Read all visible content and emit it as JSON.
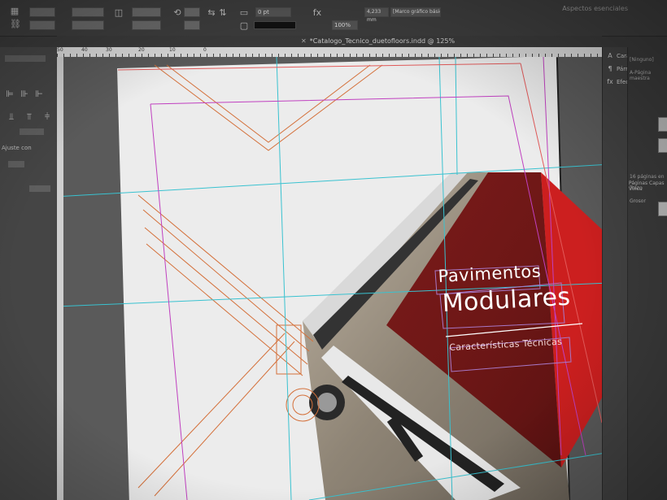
{
  "app": {
    "workspace_label": "Aspectos esenciales",
    "document_tab": {
      "title": "*Catalogo_Tecnico_duetofloors.indd @ 125%"
    }
  },
  "control_bar": {
    "stroke_weight": "0 pt",
    "zoom": "100%",
    "frame_measure": "4,233 mm",
    "paragraph_style": "[Marco gráfico básico]+"
  },
  "ruler": {
    "numbers": [
      "50",
      "40",
      "30",
      "20",
      "10",
      "0"
    ]
  },
  "left_panel": {
    "label": "Ajuste con"
  },
  "right_panel": {
    "items": [
      {
        "icon": "character-icon",
        "glyph": "A",
        "label": "Carácter"
      },
      {
        "icon": "paragraph-icon",
        "glyph": "¶",
        "label": "Párrafo"
      },
      {
        "icon": "effects-icon",
        "glyph": "fx",
        "label": "Efectos"
      }
    ],
    "side_tabs": [
      "Páginas",
      "Capas",
      "Víncu"
    ],
    "none_label": "[Ninguno]",
    "master_label": "A-Página maestra",
    "page_count": "16 páginas en",
    "stroke_tab": "Trazo",
    "stroke_field": "Grosor"
  },
  "cover": {
    "title_line1": "Pavimentos",
    "title_line2": "Modulares",
    "subtitle": "Características Técnicas",
    "colors": {
      "red": "#c91d1d",
      "dark_red": "#7e1313",
      "guide_cyan": "#39c2d0",
      "margin_magenta": "#c040c0",
      "drawing_orange": "#d4703a"
    }
  }
}
